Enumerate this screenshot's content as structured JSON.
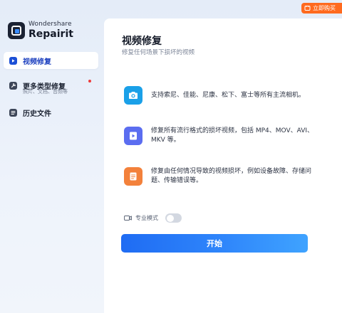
{
  "app": {
    "brand": "Wondershare",
    "product": "Repairit"
  },
  "promo": {
    "label": "立即购买"
  },
  "sidebar": {
    "items": [
      {
        "label": "视频修复",
        "icon": "video-repair-icon",
        "active": true
      },
      {
        "label": "更多类型修复",
        "sub": "照片、文档、音频等",
        "icon": "more-repair-icon",
        "has_dot": true
      },
      {
        "label": "历史文件",
        "icon": "history-icon"
      }
    ]
  },
  "main": {
    "title": "视频修复",
    "subtitle": "修复任何场景下损坏的视频",
    "features": [
      {
        "icon": "camera-icon",
        "text": "支持索尼、佳能、尼康、松下、富士等所有主流相机。"
      },
      {
        "icon": "video-file-icon",
        "text": "修复所有流行格式的损坏视频，包括 MP4、MOV、AVI、MKV 等。"
      },
      {
        "icon": "document-icon",
        "text": "修复由任何情况导致的视频损坏，例如设备故障、存储问题、传输错误等。"
      }
    ],
    "advanced_mode_label": "专业模式",
    "advanced_mode_on": false,
    "start_label": "开始"
  },
  "colors": {
    "accent": "#1f6cf3",
    "promo": "#ff6a1f",
    "camera": "#1aa0e8",
    "video": "#5b6df0",
    "document": "#f3813b"
  }
}
